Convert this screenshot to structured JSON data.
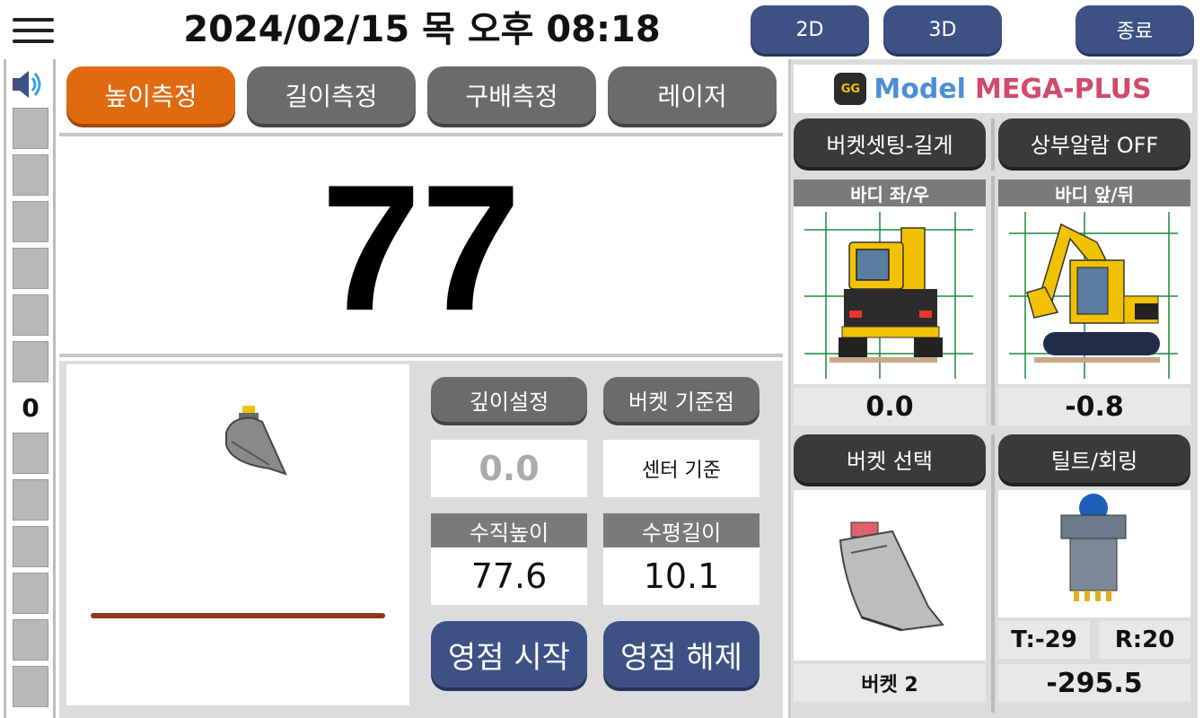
{
  "header": {
    "datetime": "2024/02/15 목 오후 08:18",
    "buttons": {
      "btn_2d": "2D",
      "btn_3d": "3D",
      "exit": "종료"
    }
  },
  "gauge": {
    "zero_label": "0"
  },
  "mode_tabs": [
    {
      "label": "높이측정",
      "active": true
    },
    {
      "label": "길이측정",
      "active": false
    },
    {
      "label": "구배측정",
      "active": false
    },
    {
      "label": "레이저",
      "active": false
    }
  ],
  "readout": {
    "value": "77"
  },
  "controls": {
    "depth_setting": "깊이설정",
    "bucket_ref": "버켓 기준점",
    "depth_value": "0.0",
    "center_ref": "센터 기준",
    "vertical_height_label": "수직높이",
    "horizontal_length_label": "수평길이",
    "vertical_height_value": "77.6",
    "horizontal_length_value": "10.1",
    "zero_start": "영점 시작",
    "zero_release": "영점 해제"
  },
  "right": {
    "logo_text": "GG",
    "model_prefix": "Model",
    "model_name": "MEGA-PLUS",
    "bucket_setting": "버켓셋팅-길게",
    "top_alarm": "상부알람 OFF",
    "body_lr_label": "바디 좌/우",
    "body_fb_label": "바디 앞/뒤",
    "body_lr_value": "0.0",
    "body_fb_value": "-0.8",
    "bucket_select": "버켓 선택",
    "tilt_rotate": "틸트/회링",
    "bucket_name": "버켓 2",
    "tilt_t": "T:-29",
    "tilt_r": "R:20",
    "tilt_value": "-295.5"
  },
  "colors": {
    "accent_orange": "#e06a10",
    "button_blue": "#3d5184",
    "button_gray": "#6b6b6b",
    "button_dark": "#3a3a3a",
    "excavator_yellow": "#f2c200"
  }
}
